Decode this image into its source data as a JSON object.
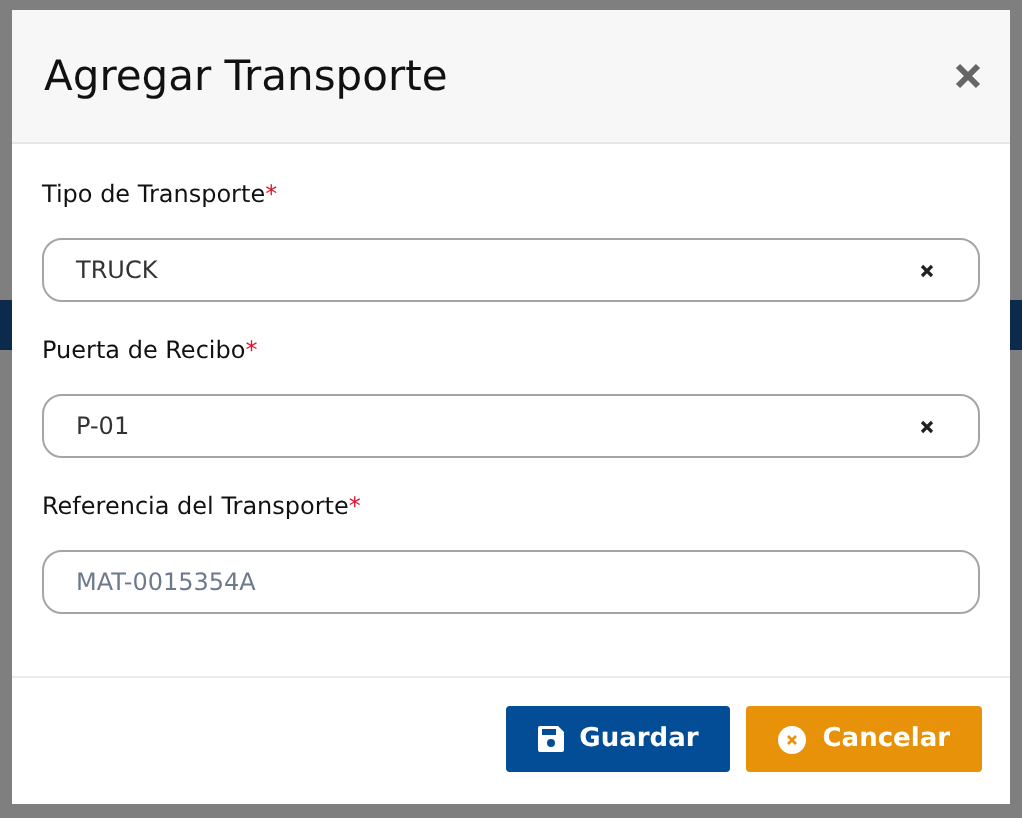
{
  "dialog": {
    "title": "Agregar Transporte",
    "fields": [
      {
        "kind": "select",
        "label": "Tipo de Transporte",
        "required_mark": "*",
        "value": "TRUCK"
      },
      {
        "kind": "select",
        "label": "Puerta de Recibo",
        "required_mark": "*",
        "value": "P-01"
      },
      {
        "kind": "input",
        "label": "Referencia del Transporte",
        "required_mark": "*",
        "placeholder": "MAT-0015354A"
      }
    ],
    "buttons": [
      {
        "kind": "save",
        "label": "Guardar"
      },
      {
        "kind": "cancel",
        "label": "Cancelar"
      }
    ]
  }
}
